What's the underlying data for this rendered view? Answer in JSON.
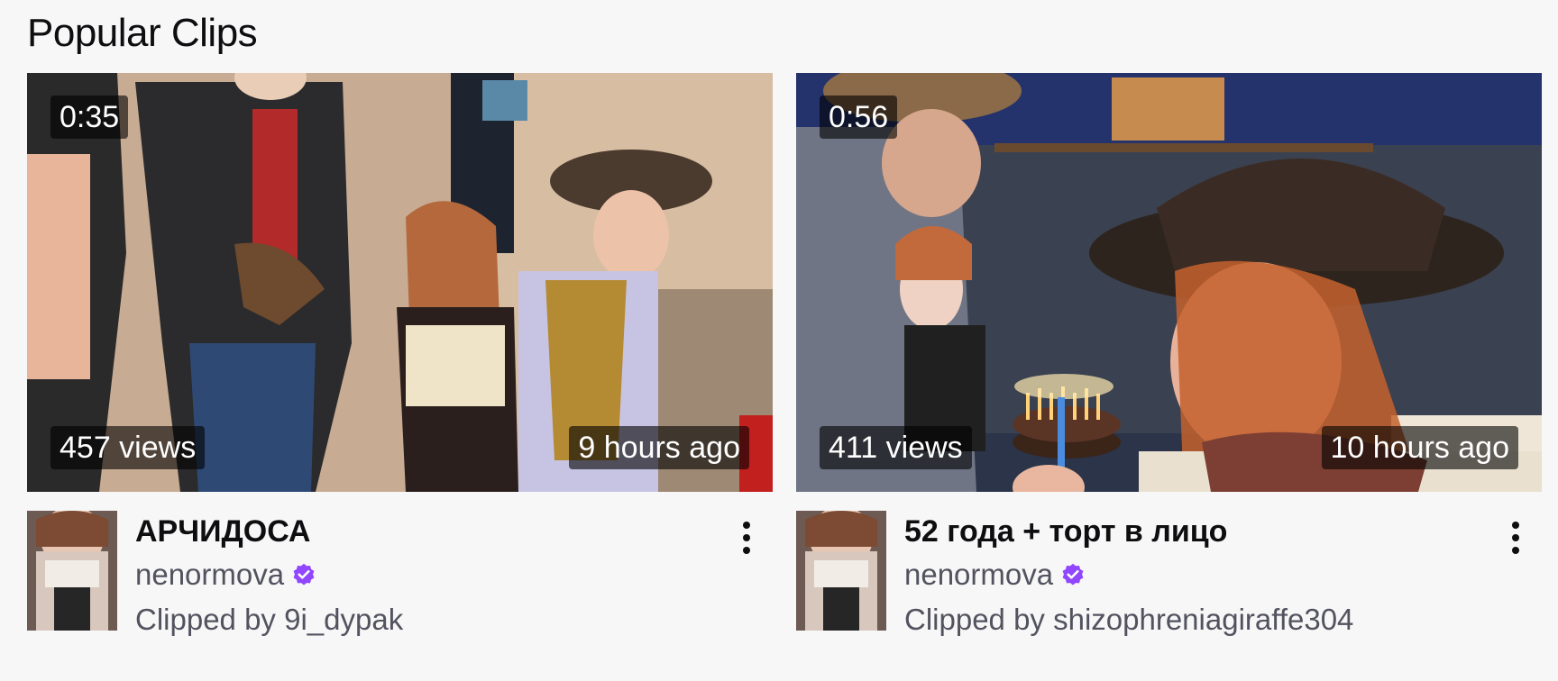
{
  "section": {
    "title": "Popular Clips"
  },
  "colors": {
    "verified": "#9147ff",
    "overlay_bg": "rgba(0,0,0,0.6)",
    "muted_text": "#53535f"
  },
  "clips": [
    {
      "duration": "0:35",
      "views": "457 views",
      "age": "9 hours ago",
      "title": "АРЧИДОСА",
      "channel": "nenormova",
      "verified": true,
      "clipped_by": "Clipped by 9i_dypak",
      "thumbnail_desc": "people in cowboy outfits near a wall",
      "avatar_icon": "channel-avatar",
      "more_icon": "more-vertical-icon"
    },
    {
      "duration": "0:56",
      "views": "411 views",
      "age": "10 hours ago",
      "title": "52 года + торт в лицо",
      "channel": "nenormova",
      "verified": true,
      "clipped_by": "Clipped by shizophreniagiraffe304",
      "thumbnail_desc": "birthday cake with candles, woman in cowboy hat",
      "avatar_icon": "channel-avatar",
      "more_icon": "more-vertical-icon"
    }
  ]
}
